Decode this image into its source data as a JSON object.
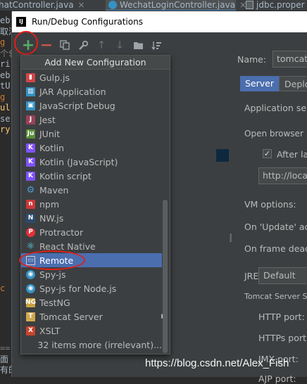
{
  "editor_tabs": [
    {
      "label": "hatController.java"
    },
    {
      "label": "WechatLoginController.java"
    },
    {
      "label": "jdbc.proper"
    }
  ],
  "code_fragments": [
    "eb",
    "取消",
    "g",
    "个$",
    "ri",
    "eb",
    "tU",
    "g",
    "ul",
    "se",
    "ry",
    "c",
    "==",
    "面",
    "有的"
  ],
  "dialog": {
    "title": "Run/Debug Configurations",
    "logo": "IJ"
  },
  "toolbar": {
    "add": "+",
    "remove": "−"
  },
  "popup": {
    "header": "Add New Configuration",
    "items": [
      {
        "label": "Gulp.js",
        "icon": "gulp-icon",
        "color": "#cf4647"
      },
      {
        "label": "JAR Application",
        "icon": "jar-icon",
        "color": "#3592c4"
      },
      {
        "label": "JavaScript Debug",
        "icon": "js-debug-icon",
        "color": "#3592c4"
      },
      {
        "label": "Jest",
        "icon": "jest-icon",
        "color": "#99425b"
      },
      {
        "label": "JUnit",
        "icon": "junit-icon",
        "color": "#5a8f3a"
      },
      {
        "label": "Kotlin",
        "icon": "kotlin-icon",
        "color": "#7f52ff"
      },
      {
        "label": "Kotlin (JavaScript)",
        "icon": "kotlin-js-icon",
        "color": "#7f52ff"
      },
      {
        "label": "Kotlin script",
        "icon": "kotlin-script-icon",
        "color": "#7f52ff"
      },
      {
        "label": "Maven",
        "icon": "maven-icon",
        "color": "#4e9ad0"
      },
      {
        "label": "npm",
        "icon": "npm-icon",
        "color": "#cb3837"
      },
      {
        "label": "NW.js",
        "icon": "nwjs-icon",
        "color": "#2c4a6e"
      },
      {
        "label": "Protractor",
        "icon": "protractor-icon",
        "color": "#e23237"
      },
      {
        "label": "React Native",
        "icon": "react-icon",
        "color": "#61dafb"
      },
      {
        "label": "Remote",
        "icon": "remote-icon",
        "color": "#d0d0d0"
      },
      {
        "label": "Spy-js",
        "icon": "spy-js-icon",
        "color": "#3592c4"
      },
      {
        "label": "Spy-js for Node.js",
        "icon": "spy-js-node-icon",
        "color": "#3592c4"
      },
      {
        "label": "TestNG",
        "icon": "testng-icon",
        "color": "#c7a341"
      },
      {
        "label": "Tomcat Server",
        "icon": "tomcat-icon",
        "color": "#d1a84e"
      },
      {
        "label": "XSLT",
        "icon": "xslt-icon",
        "color": "#c7442c"
      },
      {
        "label": "32 items more (irrelevant)...",
        "icon": "",
        "color": ""
      }
    ],
    "selected_index": 13,
    "submenu_arrow": "▶"
  },
  "config": {
    "name_label": "Name:",
    "name_value": "tomcat",
    "tabs": [
      "Server",
      "Deploy"
    ],
    "app_server_label": "Application serv",
    "open_browser_label": "Open browser",
    "after_launch_label": "After lau",
    "url_value": "http://local",
    "vm_options_label": "VM options:",
    "on_update_label": "On 'Update' act",
    "on_frame_label": "On frame deact",
    "jre_label": "JRE:",
    "jre_value": "Default",
    "tomcat_settings_label": "Tomcat Server Se",
    "http_port_label": "HTTP port:",
    "https_port_label": "HTTPs port:",
    "jmx_port_label": "JMX port:",
    "ajp_port_label": "AJP port:"
  },
  "watermark": "https://blog.csdn.net/Alex_Fish"
}
